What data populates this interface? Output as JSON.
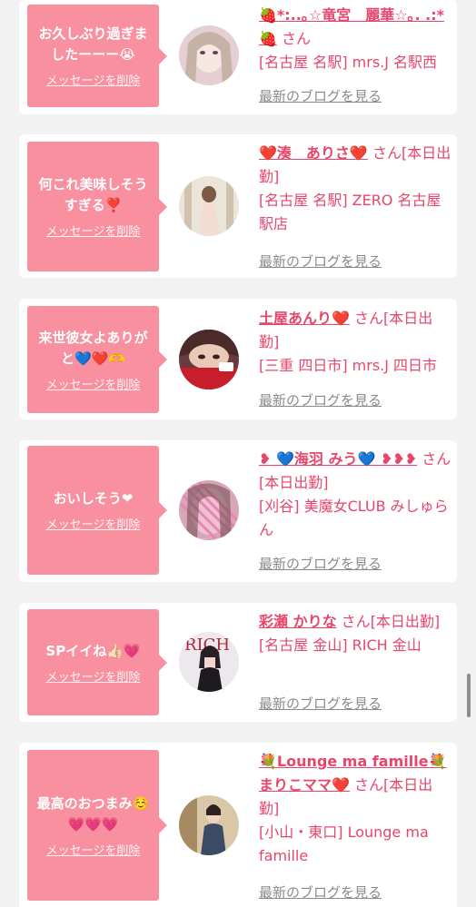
{
  "actions": {
    "delete_message_label": "メッセージを削除",
    "blog_link_label": "最新のブログを見る",
    "san_suffix": "さん"
  },
  "items": [
    {
      "message": "お久しぶり過ぎましたーーー😭",
      "name": "🍓*:..｡☆竜宮　麗華☆｡. .:*🍓",
      "status": "",
      "shop": "[名古屋 名駅] mrs.J 名駅西",
      "avatar_color": "#d9c2c8"
    },
    {
      "message": "何これ美味しそうすぎる❣️",
      "name": "❤️湊　ありさ❤️",
      "status": "[本日出勤]",
      "shop": "[名古屋 名駅] ZERO 名古屋駅店",
      "avatar_color": "#e6ddcf"
    },
    {
      "message": "来世彼女よありがと💙❤️🫶",
      "name": "土屋あんり❤️",
      "status": "[本日出勤]",
      "shop": "[三重 四日市] mrs.J 四日市",
      "avatar_color": "#a94048"
    },
    {
      "message": "おいしそう❤",
      "name": "❥ 💙海羽 みう💙 ❥❥❥",
      "status": "[本日出勤]",
      "shop": "[刈谷] 美魔女CLUB みしゅらん",
      "avatar_color": "#d99ab6"
    },
    {
      "message": "SPイイね👍🏻💗",
      "name": "彩瀬 かりな",
      "status": "[本日出勤]",
      "shop": "[名古屋 金山] RICH 金山",
      "avatar_color": "#e7e3ea"
    },
    {
      "message": "最高のおつまみ☺️💗💗💗",
      "name": "💐Lounge ma famille💐まりこママ❤️",
      "status": "[本日出勤]",
      "shop": "[小山・東口] Lounge ma famille",
      "avatar_color": "#b9a48f"
    }
  ]
}
